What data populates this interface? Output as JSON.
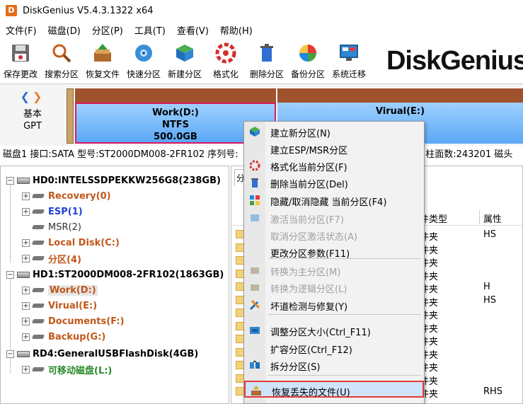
{
  "window": {
    "title": "DiskGenius V5.4.3.1322 x64",
    "app_icon_letter": "D"
  },
  "menubar": [
    "文件(F)",
    "磁盘(D)",
    "分区(P)",
    "工具(T)",
    "查看(V)",
    "帮助(H)"
  ],
  "toolbar": [
    {
      "label": "保存更改",
      "icon": "save-icon"
    },
    {
      "label": "搜索分区",
      "icon": "search-icon"
    },
    {
      "label": "恢复文件",
      "icon": "recover-icon"
    },
    {
      "label": "快速分区",
      "icon": "quick-partition-icon"
    },
    {
      "label": "新建分区",
      "icon": "new-partition-icon"
    },
    {
      "label": "格式化",
      "icon": "format-icon"
    },
    {
      "label": "删除分区",
      "icon": "delete-icon"
    },
    {
      "label": "备份分区",
      "icon": "backup-icon"
    },
    {
      "label": "系统迁移",
      "icon": "migrate-icon"
    }
  ],
  "brand": "DiskGenius",
  "diskmap": {
    "type_line1": "基本",
    "type_line2": "GPT",
    "partitions": [
      {
        "name": "Work(D:)",
        "fs": "NTFS",
        "size": "500.0GB"
      },
      {
        "name": "Virual(E:)"
      }
    ]
  },
  "disk_info": {
    "left": "磁盘1 接口:SATA 型号:ST2000DM008-2FR102 序列号:",
    "right": ") 柱面数:243201 磁头"
  },
  "tree": {
    "hd0": "HD0:INTELSSDPEKKW256G8(238GB)",
    "hd0_parts": [
      "Recovery(0)",
      "ESP(1)",
      "MSR(2)",
      "Local Disk(C:)",
      "分区(4)"
    ],
    "hd1": "HD1:ST2000DM008-2FR102(1863GB)",
    "hd1_parts": [
      "Work(D:)",
      "Virual(E:)",
      "Documents(F:)",
      "Backup(G:)"
    ],
    "rd4": "RD4:GeneralUSBFlashDisk(4GB)",
    "rd4_parts": [
      "可移动磁盘(L:)"
    ]
  },
  "filelist": {
    "tab_stub": "分",
    "col_type": "件类型",
    "col_attr": "属性",
    "rows": [
      {
        "type": "件夹",
        "attr": "HS"
      },
      {
        "type": "件夹",
        "attr": ""
      },
      {
        "type": "件夹",
        "attr": ""
      },
      {
        "type": "件夹",
        "attr": ""
      },
      {
        "type": "件夹",
        "attr": "H"
      },
      {
        "type": "件夹",
        "attr": "HS"
      },
      {
        "type": "件夹",
        "attr": ""
      },
      {
        "type": "件夹",
        "attr": ""
      },
      {
        "type": "件夹",
        "attr": ""
      },
      {
        "type": "件夹",
        "attr": ""
      },
      {
        "type": "件夹",
        "attr": ""
      },
      {
        "type": "件夹",
        "attr": ""
      },
      {
        "type": "件夹",
        "attr": "RHS"
      }
    ]
  },
  "context_menu": [
    {
      "label": "建立新分区(N)",
      "icon": "new-partition-icon",
      "enabled": true
    },
    {
      "label": "建立ESP/MSR分区",
      "icon": "",
      "enabled": true
    },
    {
      "label": "格式化当前分区(F)",
      "icon": "format-icon",
      "enabled": true
    },
    {
      "label": "删除当前分区(Del)",
      "icon": "delete-icon",
      "enabled": true
    },
    {
      "label": "隐藏/取消隐藏 当前分区(F4)",
      "icon": "hide-icon",
      "enabled": true
    },
    {
      "label": "激活当前分区(F7)",
      "icon": "activate-icon",
      "enabled": false
    },
    {
      "label": "取消分区激活状态(A)",
      "icon": "",
      "enabled": false
    },
    {
      "label": "更改分区参数(F11)",
      "icon": "",
      "enabled": true
    },
    {
      "label": "转换为主分区(M)",
      "icon": "convert-primary-icon",
      "enabled": false
    },
    {
      "label": "转换为逻辑分区(L)",
      "icon": "convert-logical-icon",
      "enabled": false
    },
    {
      "label": "坏道检测与修复(Y)",
      "icon": "repair-icon",
      "enabled": true
    },
    {
      "label": "调整分区大小(Ctrl_F11)",
      "icon": "resize-icon",
      "enabled": true
    },
    {
      "label": "扩容分区(Ctrl_F12)",
      "icon": "",
      "enabled": true
    },
    {
      "label": "拆分分区(S)",
      "icon": "split-icon",
      "enabled": true
    },
    {
      "label": "恢复丢失的文件(U)",
      "icon": "recover-icon",
      "enabled": true,
      "highlighted": true
    }
  ]
}
